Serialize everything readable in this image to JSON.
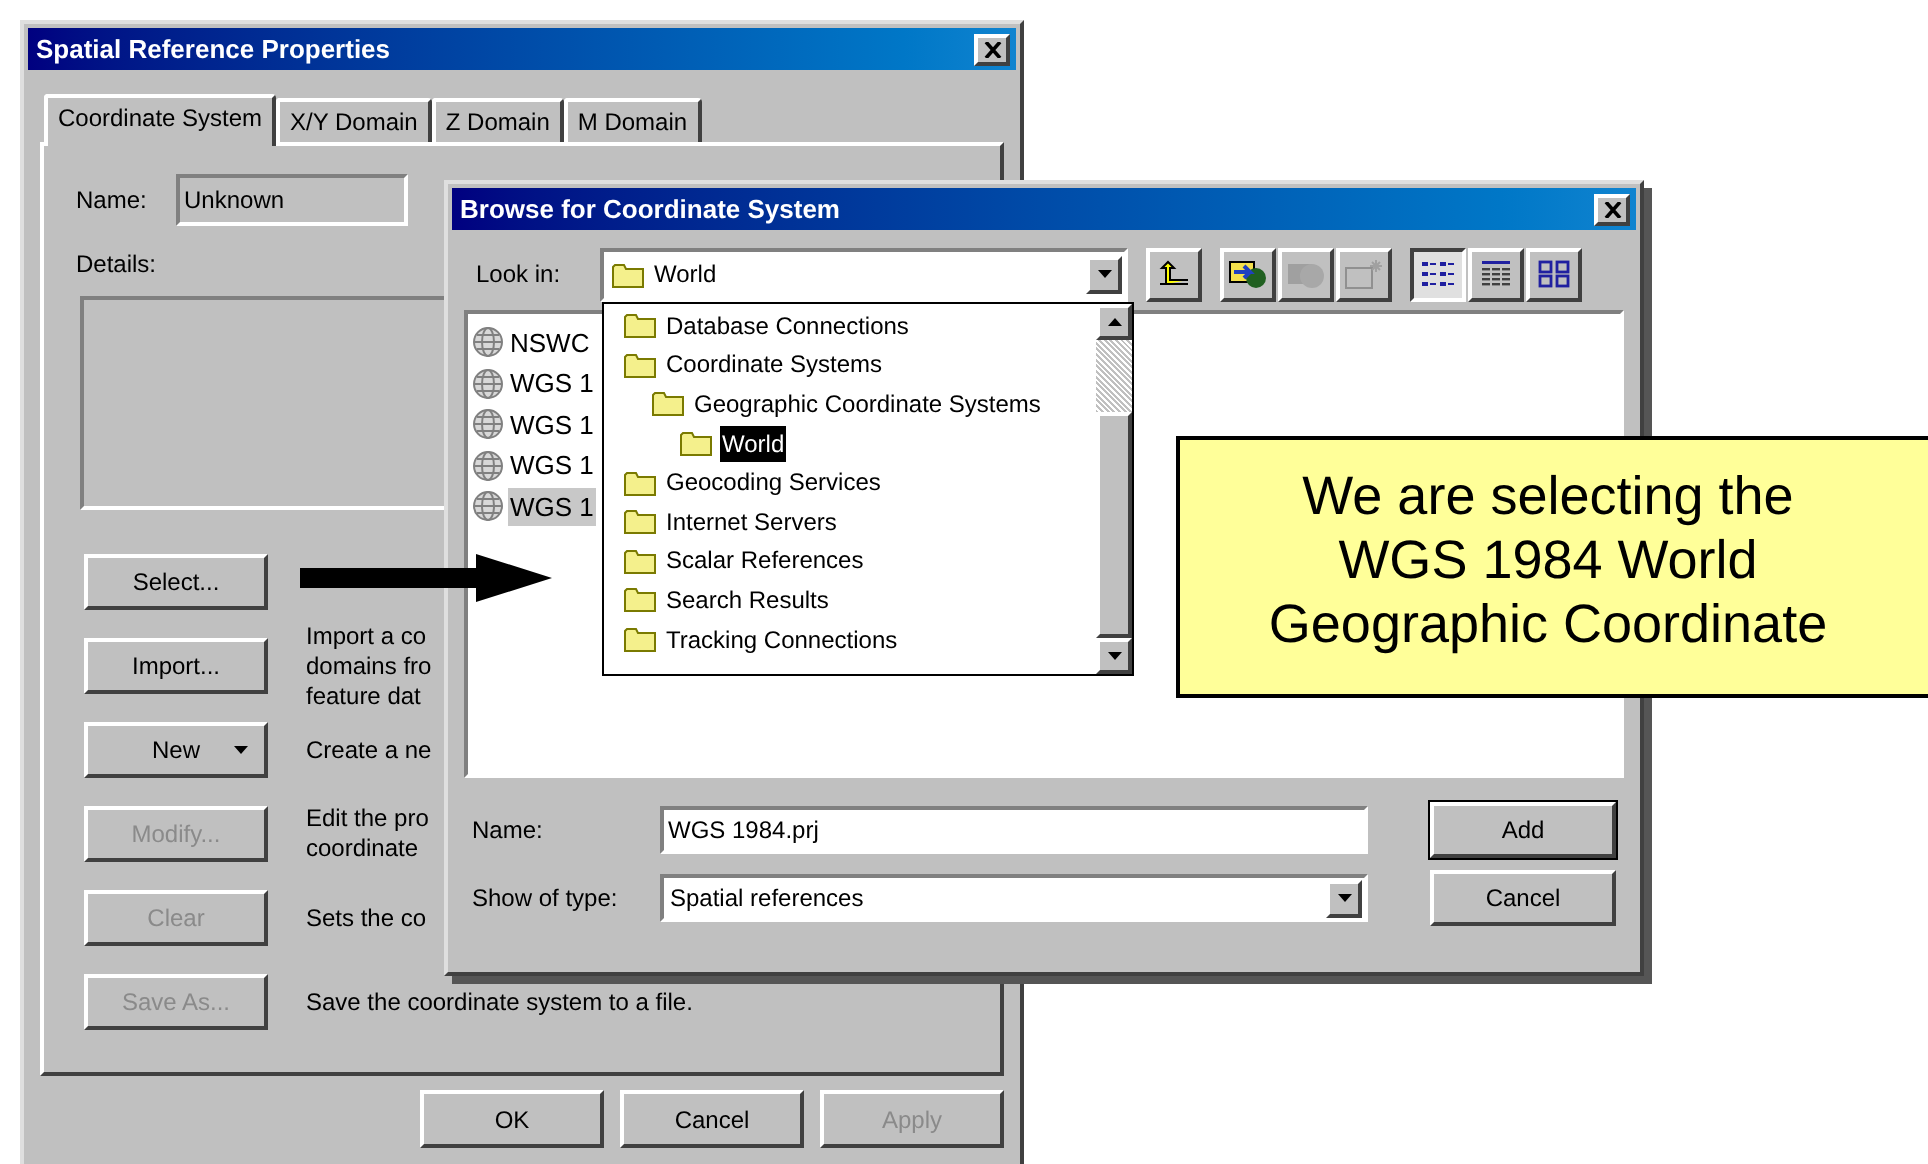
{
  "properties_window": {
    "title": "Spatial Reference Properties",
    "tabs": [
      {
        "label": "Coordinate System",
        "selected": true
      },
      {
        "label": "X/Y Domain",
        "selected": false
      },
      {
        "label": "Z Domain",
        "selected": false
      },
      {
        "label": "M Domain",
        "selected": false
      }
    ],
    "name_label": "Name:",
    "name_value": "Unknown",
    "details_label": "Details:",
    "actions": [
      {
        "label": "Select...",
        "kind": "push",
        "disabled": false
      },
      {
        "label": "Import...",
        "kind": "push",
        "disabled": false,
        "description": [
          "Import a co",
          "domains fro",
          "feature dat"
        ]
      },
      {
        "label": "New",
        "kind": "menu",
        "disabled": false,
        "description": [
          "Create a ne"
        ]
      },
      {
        "label": "Modify...",
        "kind": "push",
        "disabled": true,
        "description": [
          "Edit the pro",
          "coordinate"
        ]
      },
      {
        "label": "Clear",
        "kind": "push",
        "disabled": true,
        "description": [
          "Sets the co"
        ]
      },
      {
        "label": "Save As...",
        "kind": "push",
        "disabled": true,
        "description": [
          "Save the coordinate system to a file."
        ]
      }
    ],
    "buttons": [
      {
        "label": "OK",
        "disabled": false
      },
      {
        "label": "Cancel",
        "disabled": false
      },
      {
        "label": "Apply",
        "disabled": true
      }
    ]
  },
  "browse_window": {
    "title": "Browse for Coordinate System",
    "look_in_label": "Look in:",
    "look_in_value": "World",
    "toolbar": [
      {
        "kind": "up",
        "disabled": false
      },
      {
        "kind": "connect",
        "disabled": false
      },
      {
        "kind": "disconnect",
        "disabled": true
      },
      {
        "kind": "new",
        "disabled": true
      }
    ],
    "views": [
      {
        "kind": "list",
        "selected": true
      },
      {
        "kind": "details",
        "selected": false
      },
      {
        "kind": "large",
        "selected": false
      }
    ],
    "files": [
      {
        "label": "NSWC",
        "selected": false
      },
      {
        "label": "WGS 1",
        "selected": false
      },
      {
        "label": "WGS 1",
        "selected": false
      },
      {
        "label": "WGS 1",
        "selected": false
      },
      {
        "label": "WGS 1",
        "selected": true
      }
    ],
    "locations": [
      {
        "label": "Database Connections",
        "selected": false
      },
      {
        "label": "Coordinate Systems",
        "selected": false,
        "children": [
          {
            "label": "Geographic Coordinate Systems",
            "selected": false,
            "children": [
              {
                "label": "World",
                "selected": true
              }
            ]
          }
        ]
      },
      {
        "label": "Geocoding Services",
        "selected": false
      },
      {
        "label": "Internet Servers",
        "selected": false
      },
      {
        "label": "Scalar References",
        "selected": false
      },
      {
        "label": "Search Results",
        "selected": false
      },
      {
        "label": "Tracking Connections",
        "selected": false
      }
    ],
    "name_label": "Name:",
    "name_value": "WGS 1984.prj",
    "type_label": "Show of type:",
    "type_value": "Spatial references",
    "buttons": [
      {
        "label": "Add",
        "default": true
      },
      {
        "label": "Cancel",
        "default": false
      }
    ]
  },
  "callout": {
    "lines": [
      "We are selecting the",
      "WGS 1984 World",
      "Geographic Coordinate"
    ]
  }
}
